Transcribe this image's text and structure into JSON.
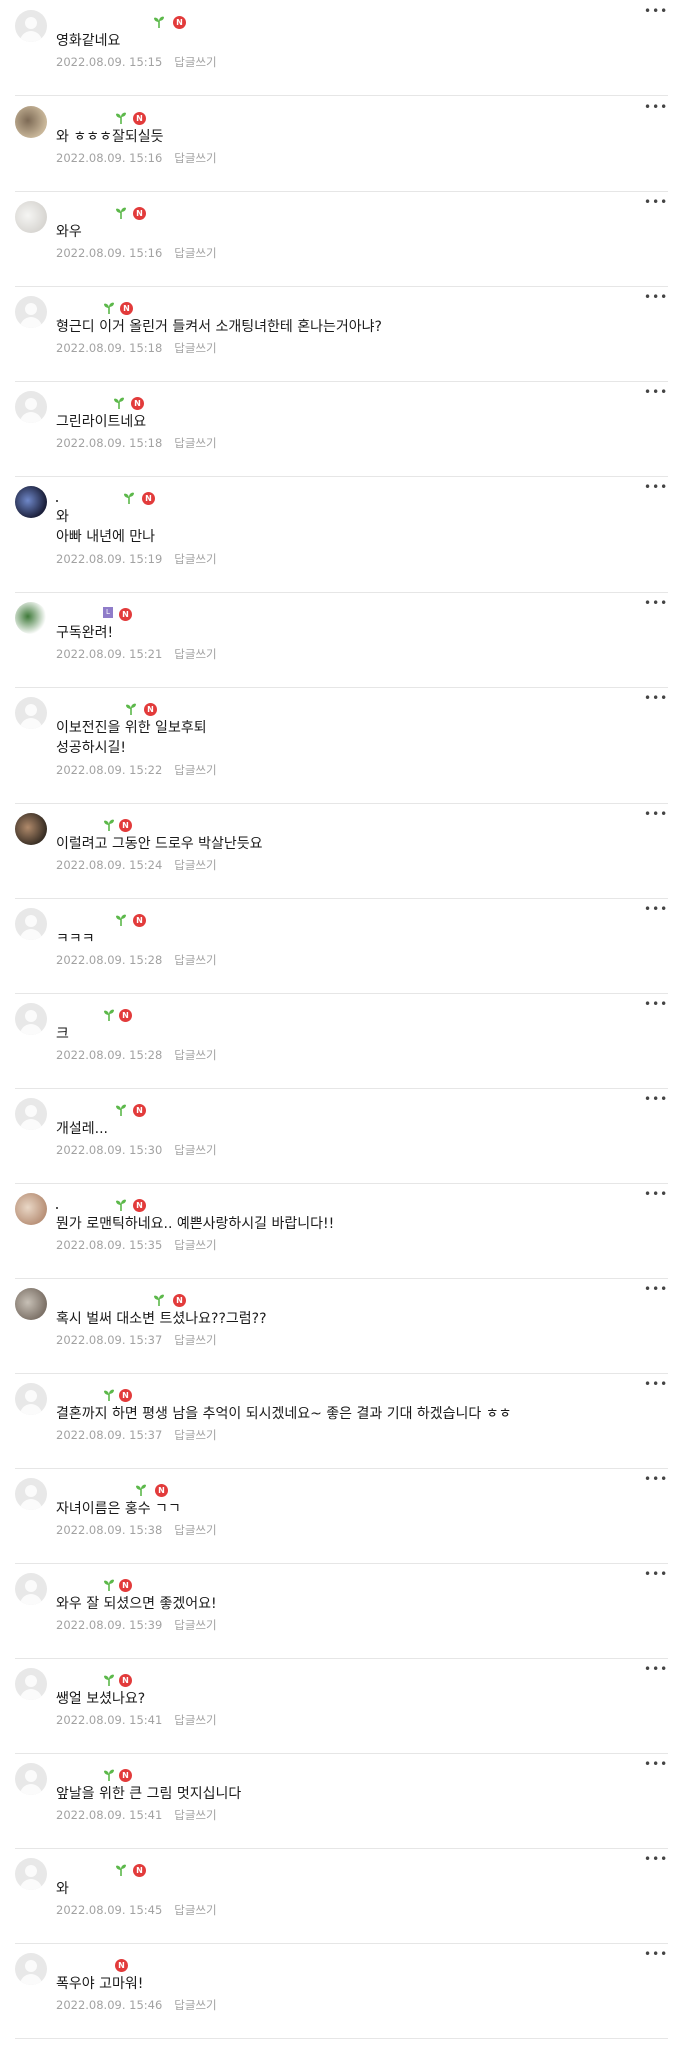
{
  "colors": {
    "badge_new": "#e23b3b",
    "sprout": "#5cb84a",
    "divider": "#e6e6e6",
    "meta_text": "#a2a2a2"
  },
  "icons": {
    "more": "more-options-icon",
    "new_badge_text": "N",
    "level_badge_text": "L"
  },
  "reply_label": "답글쓰기",
  "comments": [
    {
      "text": "영화같네요",
      "date": "2022.08.09. 15:15",
      "avatar": "default"
    },
    {
      "text": "와 ㅎㅎㅎ잘되실듯",
      "date": "2022.08.09. 15:16",
      "avatar": "photo"
    },
    {
      "text": "와우",
      "date": "2022.08.09. 15:16",
      "avatar": "photo"
    },
    {
      "text": "형근디 이거 올린거 들켜서 소개팅녀한테 혼나는거아냐?",
      "date": "2022.08.09. 15:18",
      "avatar": "default"
    },
    {
      "text": "그린라이트네요",
      "date": "2022.08.09. 15:18",
      "avatar": "default"
    },
    {
      "text": "와\n아빠 내년에 만나",
      "date": "2022.08.09. 15:19",
      "avatar": "photo"
    },
    {
      "text": "구독완려!",
      "date": "2022.08.09. 15:21",
      "avatar": "plant"
    },
    {
      "text": "이보전진을 위한 일보후퇴\n성공하시길!",
      "date": "2022.08.09. 15:22",
      "avatar": "default"
    },
    {
      "text": "이럴려고 그동안 드로우 박살난듯요",
      "date": "2022.08.09. 15:24",
      "avatar": "photo"
    },
    {
      "text": "ㅋㅋㅋ",
      "date": "2022.08.09. 15:28",
      "avatar": "default"
    },
    {
      "text": "크",
      "date": "2022.08.09. 15:28",
      "avatar": "default"
    },
    {
      "text": "개설레...",
      "date": "2022.08.09. 15:30",
      "avatar": "default"
    },
    {
      "text": "뭔가 로맨틱하네요.. 예쁜사랑하시길 바랍니다!!",
      "date": "2022.08.09. 15:35",
      "avatar": "photo"
    },
    {
      "text": "혹시 벌써 대소변 트셨나요??그럼??",
      "date": "2022.08.09. 15:37",
      "avatar": "photo"
    },
    {
      "text": "결혼까지 하면 평생 남을 추억이 되시겠네요~ 좋은 결과 기대 하겠습니다 ㅎㅎ",
      "date": "2022.08.09. 15:37",
      "avatar": "default"
    },
    {
      "text": "자녀이름은 홍수 ㄱㄱ",
      "date": "2022.08.09. 15:38",
      "avatar": "default"
    },
    {
      "text": "와우 잘 되셨으면 좋겠어요!",
      "date": "2022.08.09. 15:39",
      "avatar": "default"
    },
    {
      "text": "쌩얼 보셨나요?",
      "date": "2022.08.09. 15:41",
      "avatar": "default"
    },
    {
      "text": "앞날을 위한 큰 그림 멋지십니다",
      "date": "2022.08.09. 15:41",
      "avatar": "default"
    },
    {
      "text": "와",
      "date": "2022.08.09. 15:45",
      "avatar": "default"
    },
    {
      "text": "폭우야 고마워!",
      "date": "2022.08.09. 15:46",
      "avatar": "default"
    }
  ]
}
